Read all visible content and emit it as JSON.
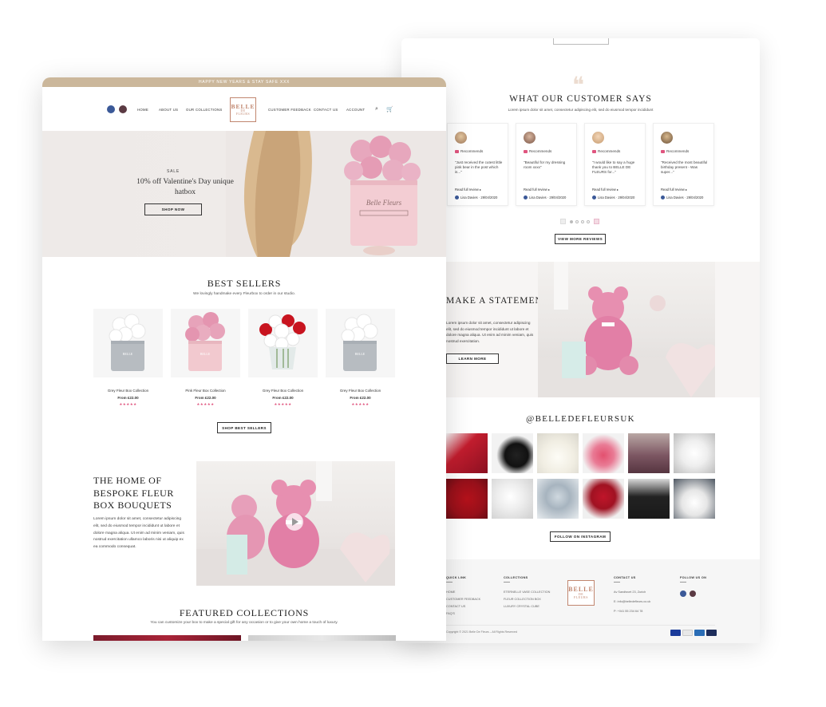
{
  "front": {
    "announcement": "HAPPY NEW YEARS & STAY SAFE XXX",
    "nav_left": [
      "HOME",
      "ABOUT US",
      "OUR COLLECTIONS"
    ],
    "nav_right": [
      "CUSTOMER FEEDBACK",
      "CONTACT US",
      "ACCOUNT"
    ],
    "logo": {
      "line1": "BELLE",
      "line2": "DE",
      "line3": "FLEURS"
    },
    "icons": {
      "facebook": "facebook-icon",
      "instagram": "instagram-icon",
      "search": "search-icon",
      "cart": "cart-icon"
    },
    "hero": {
      "eyebrow": "SALE",
      "title": "10% off Valentine's Day unique hatbox",
      "button": "SHOP NOW"
    },
    "best_sellers": {
      "title": "BEST SELLERS",
      "subtitle": "We lovingly handmake every Fleurbox to order in our studio.",
      "button": "SHOP BEST SELLERS",
      "products": [
        {
          "name": "Grey Fleur Box Collection",
          "price": "From £22.00",
          "stars": "★★★★★",
          "rating": 5
        },
        {
          "name": "Pink Fleur Box Collection",
          "price": "From £22.00",
          "stars": "★★★★★",
          "rating": 5
        },
        {
          "name": "Grey Fleur Box Collection",
          "price": "From £22.00",
          "stars": "★★★★★",
          "rating": 5
        },
        {
          "name": "Grey Fleur Box Collection",
          "price": "From £22.00",
          "stars": "★★★★★",
          "rating": 5
        }
      ]
    },
    "home_section": {
      "title": "THE HOME OF BESPOKE FLEUR BOX BOUQUETS",
      "body": "Lorem ipsum dolor sit amet, consectetur adipiscing elit, sed do eiusmod tempor incididunt ut labore et dolore magna aliqua. Ut enim ad minim veniam, quis nostrud exercitation ullamco laboris nisi ut aliquip ex ea commodo consequat."
    },
    "featured": {
      "title": "FEATURED COLLECTIONS",
      "subtitle": "You can customize your box to make a special gift for any occasion or to give your own home a touch of luxury."
    }
  },
  "back": {
    "reviews": {
      "title": "WHAT OUR CUSTOMER SAYS",
      "subtitle": "Lorem ipsum dolor sit amet, consectetur adipiscing elit, sed do eiusmod tempor incididunt",
      "button": "VIEW MORE REVIEWS",
      "cards": [
        {
          "recommends": "Recommends",
          "text": "\"Just received the cutest little pink bear in the post which is...\"",
          "read": "Read full review ▸",
          "meta": "Lisa Davies · 29/04/2020"
        },
        {
          "recommends": "Recommends",
          "text": "\"Beautiful for my dressing room xxxx\"",
          "read": "Read full review ▸",
          "meta": "Lisa Davies · 29/04/2020"
        },
        {
          "recommends": "Recommends",
          "text": "\"I would like to say a huge thank you to BELLE DE FLEURS for...\"",
          "read": "Read full review ▸",
          "meta": "Lisa Davies · 29/04/2020"
        },
        {
          "recommends": "Recommends",
          "text": "\"Received the most beautiful birthday present - Was super...\"",
          "read": "Read full review ▸",
          "meta": "Lisa Davies · 29/04/2020"
        }
      ]
    },
    "statement": {
      "title": "MAKE A STATEMENT",
      "body": "Lorem ipsum dolor sit amet, consectetur adipiscing elit, sed do eiusmod tempor incididunt ut labore et dolore magna aliqua. Ut enim ad minim veniam, quis nostrud exercitation.",
      "button": "LEARN MORE"
    },
    "instagram": {
      "title": "@BELLEDEFLEURSUK",
      "button": "FOLLOW ON INSTAGRAM"
    },
    "footer": {
      "quick_link_head": "QUICK LINK",
      "quick_links": [
        "HOME",
        "CUSTOMER FEEDBACK",
        "CONTACT US",
        "FAQ'S"
      ],
      "collections_head": "COLLECTIONS",
      "collections": [
        "ETERNELLE VASE COLLECTION",
        "FLEUR COLLECTION BOX",
        "LUXURY CRYSTAL CUBE"
      ],
      "contact_head": "CONTACT US",
      "contact": [
        "Av Sandtsvet 23, Zurich",
        "E: info@belledefleurs.co.uk",
        "P: +041 55 234 64 78"
      ],
      "follow_head": "FOLLOW US ON",
      "copyright": "Copyright © 2021 Belle De Fleurs – All Rights Reserved",
      "payments": [
        "VISA",
        "MC",
        "AMEX",
        "PP"
      ]
    }
  }
}
